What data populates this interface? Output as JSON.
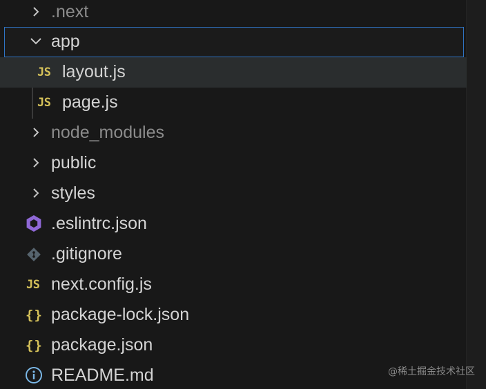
{
  "tree": {
    "next_folder": ".next",
    "app_folder": "app",
    "app_children": {
      "layout": {
        "name": "layout.js",
        "icon_text": "JS"
      },
      "page": {
        "name": "page.js",
        "icon_text": "JS"
      }
    },
    "node_modules_folder": "node_modules",
    "public_folder": "public",
    "styles_folder": "styles",
    "files": {
      "eslintrc": ".eslintrc.json",
      "gitignore": ".gitignore",
      "next_config": {
        "name": "next.config.js",
        "icon_text": "JS"
      },
      "package_lock": {
        "name": "package-lock.json",
        "icon_text": "{}"
      },
      "package": {
        "name": "package.json",
        "icon_text": "{}"
      },
      "readme": "README.md"
    }
  },
  "watermark": "@稀土掘金技术社区",
  "colors": {
    "selection_border": "#2f74c4",
    "js_icon": "#d6c25a",
    "eslint_icon": "#8f68d6",
    "git_icon": "#56646e",
    "info_icon": "#7ab7e6"
  }
}
